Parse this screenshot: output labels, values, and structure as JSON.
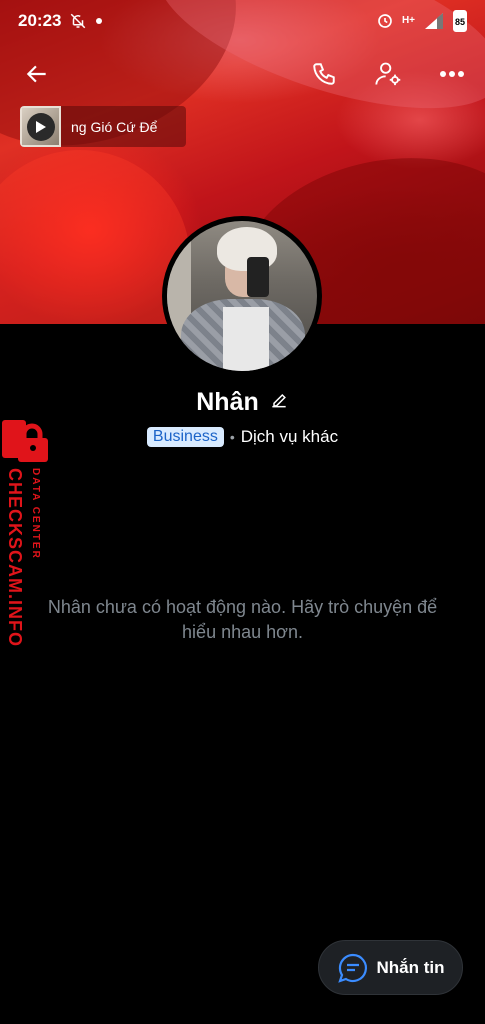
{
  "status_bar": {
    "time": "20:23",
    "network": "H+",
    "battery": "85"
  },
  "music": {
    "title": "ng Gió Cứ Để"
  },
  "profile": {
    "name": "Nhân",
    "badge": "Business",
    "separator": "•",
    "category": "Dịch vụ khác"
  },
  "feed": {
    "empty_message": "Nhân chưa có hoạt động nào. Hãy trò chuyện để hiểu nhau hơn."
  },
  "watermark": {
    "line1": "CHECKSCAM.INFO",
    "line2": "DATA CENTER"
  },
  "actions": {
    "message_label": "Nhắn tin"
  },
  "colors": {
    "accent": "#1c64c8",
    "badge_bg": "#d9ebff",
    "watermark": "#e0141a",
    "muted_text": "#7f878f"
  }
}
